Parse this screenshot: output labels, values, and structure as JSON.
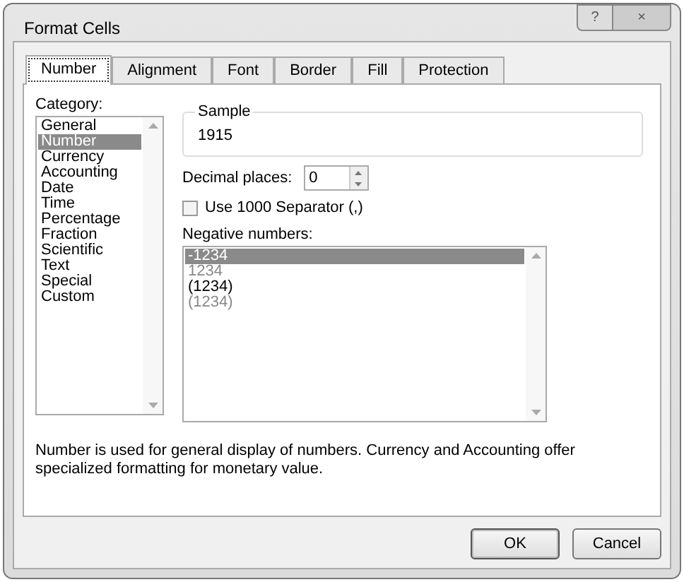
{
  "window": {
    "title": "Format Cells",
    "help_button": "?",
    "close_button": "×"
  },
  "tabs": [
    {
      "label": "Number",
      "selected": true
    },
    {
      "label": "Alignment",
      "selected": false
    },
    {
      "label": "Font",
      "selected": false
    },
    {
      "label": "Border",
      "selected": false
    },
    {
      "label": "Fill",
      "selected": false
    },
    {
      "label": "Protection",
      "selected": false
    }
  ],
  "category": {
    "label": "Category:",
    "items": [
      {
        "label": "General",
        "selected": false
      },
      {
        "label": "Number",
        "selected": true
      },
      {
        "label": "Currency",
        "selected": false
      },
      {
        "label": "Accounting",
        "selected": false
      },
      {
        "label": "Date",
        "selected": false
      },
      {
        "label": "Time",
        "selected": false
      },
      {
        "label": "Percentage",
        "selected": false
      },
      {
        "label": "Fraction",
        "selected": false
      },
      {
        "label": "Scientific",
        "selected": false
      },
      {
        "label": "Text",
        "selected": false
      },
      {
        "label": "Special",
        "selected": false
      },
      {
        "label": "Custom",
        "selected": false
      }
    ]
  },
  "sample": {
    "label": "Sample",
    "value": "1915"
  },
  "decimal_places": {
    "label": "Decimal places:",
    "value": "0"
  },
  "separator": {
    "label": "Use 1000 Separator (,)",
    "checked": false
  },
  "negative_numbers": {
    "label": "Negative numbers:",
    "items": [
      {
        "label": "-1234",
        "selected": true
      },
      {
        "label": "1234",
        "selected": false,
        "color": "#888888"
      },
      {
        "label": "(1234)",
        "selected": false,
        "color": "#000000"
      },
      {
        "label": "(1234)",
        "selected": false,
        "color": "#888888"
      }
    ]
  },
  "description": "Number is used for general display of numbers.  Currency and Accounting offer specialized formatting for monetary value.",
  "buttons": [
    {
      "label": "OK",
      "kind": "default"
    },
    {
      "label": "Cancel",
      "kind": "normal"
    }
  ]
}
